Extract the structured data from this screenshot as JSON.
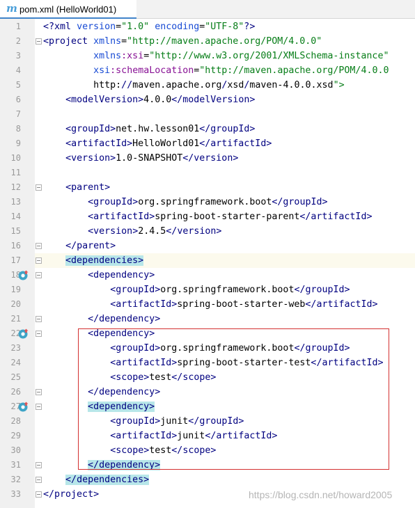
{
  "tab": {
    "icon": "maven-m-icon",
    "title": "pom.xml (HelloWorld01)"
  },
  "colors": {
    "tag": "#000080",
    "attr_value": "#067d17",
    "namespace": "#871094",
    "brace_match": "#b7e6e9",
    "selection_box": "#d32f2f",
    "current_line": "#fcfaed"
  },
  "editor": {
    "current_line": 17,
    "gutter_icons": [
      {
        "line": 18,
        "icon": "maven-override-icon"
      },
      {
        "line": 22,
        "icon": "maven-override-icon"
      },
      {
        "line": 27,
        "icon": "maven-override-icon"
      }
    ],
    "lines": [
      {
        "n": 1,
        "text": "<?xml version=\"1.0\" encoding=\"UTF-8\"?>"
      },
      {
        "n": 2,
        "text": "<project xmlns=\"http://maven.apache.org/POM/4.0.0\""
      },
      {
        "n": 3,
        "text": "         xmlns:xsi=\"http://www.w3.org/2001/XMLSchema-instance\""
      },
      {
        "n": 4,
        "text": "         xsi:schemaLocation=\"http://maven.apache.org/POM/4.0.0"
      },
      {
        "n": 5,
        "text": "         http://maven.apache.org/xsd/maven-4.0.0.xsd\">"
      },
      {
        "n": 6,
        "text": "    <modelVersion>4.0.0</modelVersion>"
      },
      {
        "n": 7,
        "text": ""
      },
      {
        "n": 8,
        "text": "    <groupId>net.hw.lesson01</groupId>"
      },
      {
        "n": 9,
        "text": "    <artifactId>HelloWorld01</artifactId>"
      },
      {
        "n": 10,
        "text": "    <version>1.0-SNAPSHOT</version>"
      },
      {
        "n": 11,
        "text": ""
      },
      {
        "n": 12,
        "text": "    <parent>"
      },
      {
        "n": 13,
        "text": "        <groupId>org.springframework.boot</groupId>"
      },
      {
        "n": 14,
        "text": "        <artifactId>spring-boot-starter-parent</artifactId>"
      },
      {
        "n": 15,
        "text": "        <version>2.4.5</version>"
      },
      {
        "n": 16,
        "text": "    </parent>"
      },
      {
        "n": 17,
        "text": "    <dependencies>"
      },
      {
        "n": 18,
        "text": "        <dependency>"
      },
      {
        "n": 19,
        "text": "            <groupId>org.springframework.boot</groupId>"
      },
      {
        "n": 20,
        "text": "            <artifactId>spring-boot-starter-web</artifactId>"
      },
      {
        "n": 21,
        "text": "        </dependency>"
      },
      {
        "n": 22,
        "text": "        <dependency>"
      },
      {
        "n": 23,
        "text": "            <groupId>org.springframework.boot</groupId>"
      },
      {
        "n": 24,
        "text": "            <artifactId>spring-boot-starter-test</artifactId>"
      },
      {
        "n": 25,
        "text": "            <scope>test</scope>"
      },
      {
        "n": 26,
        "text": "        </dependency>"
      },
      {
        "n": 27,
        "text": "        <dependency>"
      },
      {
        "n": 28,
        "text": "            <groupId>junit</groupId>"
      },
      {
        "n": 29,
        "text": "            <artifactId>junit</artifactId>"
      },
      {
        "n": 30,
        "text": "            <scope>test</scope>"
      },
      {
        "n": 31,
        "text": "        </dependency>"
      },
      {
        "n": 32,
        "text": "    </dependencies>"
      },
      {
        "n": 33,
        "text": "</project>"
      }
    ]
  },
  "watermark": "https://blog.csdn.net/howard2005"
}
